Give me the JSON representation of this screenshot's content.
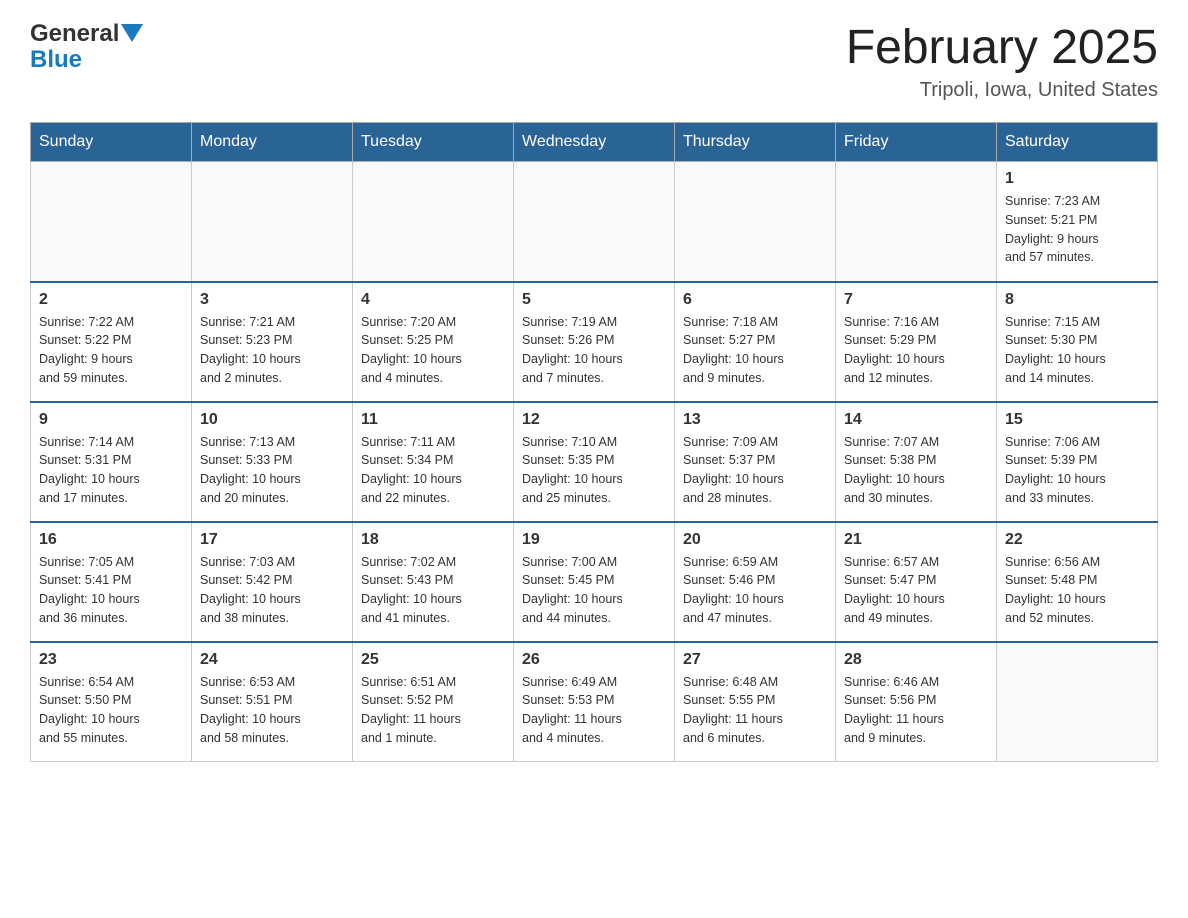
{
  "header": {
    "logo_general": "General",
    "logo_blue": "Blue",
    "month_title": "February 2025",
    "location": "Tripoli, Iowa, United States"
  },
  "days_of_week": [
    "Sunday",
    "Monday",
    "Tuesday",
    "Wednesday",
    "Thursday",
    "Friday",
    "Saturday"
  ],
  "weeks": [
    [
      {
        "day": "",
        "info": ""
      },
      {
        "day": "",
        "info": ""
      },
      {
        "day": "",
        "info": ""
      },
      {
        "day": "",
        "info": ""
      },
      {
        "day": "",
        "info": ""
      },
      {
        "day": "",
        "info": ""
      },
      {
        "day": "1",
        "info": "Sunrise: 7:23 AM\nSunset: 5:21 PM\nDaylight: 9 hours\nand 57 minutes."
      }
    ],
    [
      {
        "day": "2",
        "info": "Sunrise: 7:22 AM\nSunset: 5:22 PM\nDaylight: 9 hours\nand 59 minutes."
      },
      {
        "day": "3",
        "info": "Sunrise: 7:21 AM\nSunset: 5:23 PM\nDaylight: 10 hours\nand 2 minutes."
      },
      {
        "day": "4",
        "info": "Sunrise: 7:20 AM\nSunset: 5:25 PM\nDaylight: 10 hours\nand 4 minutes."
      },
      {
        "day": "5",
        "info": "Sunrise: 7:19 AM\nSunset: 5:26 PM\nDaylight: 10 hours\nand 7 minutes."
      },
      {
        "day": "6",
        "info": "Sunrise: 7:18 AM\nSunset: 5:27 PM\nDaylight: 10 hours\nand 9 minutes."
      },
      {
        "day": "7",
        "info": "Sunrise: 7:16 AM\nSunset: 5:29 PM\nDaylight: 10 hours\nand 12 minutes."
      },
      {
        "day": "8",
        "info": "Sunrise: 7:15 AM\nSunset: 5:30 PM\nDaylight: 10 hours\nand 14 minutes."
      }
    ],
    [
      {
        "day": "9",
        "info": "Sunrise: 7:14 AM\nSunset: 5:31 PM\nDaylight: 10 hours\nand 17 minutes."
      },
      {
        "day": "10",
        "info": "Sunrise: 7:13 AM\nSunset: 5:33 PM\nDaylight: 10 hours\nand 20 minutes."
      },
      {
        "day": "11",
        "info": "Sunrise: 7:11 AM\nSunset: 5:34 PM\nDaylight: 10 hours\nand 22 minutes."
      },
      {
        "day": "12",
        "info": "Sunrise: 7:10 AM\nSunset: 5:35 PM\nDaylight: 10 hours\nand 25 minutes."
      },
      {
        "day": "13",
        "info": "Sunrise: 7:09 AM\nSunset: 5:37 PM\nDaylight: 10 hours\nand 28 minutes."
      },
      {
        "day": "14",
        "info": "Sunrise: 7:07 AM\nSunset: 5:38 PM\nDaylight: 10 hours\nand 30 minutes."
      },
      {
        "day": "15",
        "info": "Sunrise: 7:06 AM\nSunset: 5:39 PM\nDaylight: 10 hours\nand 33 minutes."
      }
    ],
    [
      {
        "day": "16",
        "info": "Sunrise: 7:05 AM\nSunset: 5:41 PM\nDaylight: 10 hours\nand 36 minutes."
      },
      {
        "day": "17",
        "info": "Sunrise: 7:03 AM\nSunset: 5:42 PM\nDaylight: 10 hours\nand 38 minutes."
      },
      {
        "day": "18",
        "info": "Sunrise: 7:02 AM\nSunset: 5:43 PM\nDaylight: 10 hours\nand 41 minutes."
      },
      {
        "day": "19",
        "info": "Sunrise: 7:00 AM\nSunset: 5:45 PM\nDaylight: 10 hours\nand 44 minutes."
      },
      {
        "day": "20",
        "info": "Sunrise: 6:59 AM\nSunset: 5:46 PM\nDaylight: 10 hours\nand 47 minutes."
      },
      {
        "day": "21",
        "info": "Sunrise: 6:57 AM\nSunset: 5:47 PM\nDaylight: 10 hours\nand 49 minutes."
      },
      {
        "day": "22",
        "info": "Sunrise: 6:56 AM\nSunset: 5:48 PM\nDaylight: 10 hours\nand 52 minutes."
      }
    ],
    [
      {
        "day": "23",
        "info": "Sunrise: 6:54 AM\nSunset: 5:50 PM\nDaylight: 10 hours\nand 55 minutes."
      },
      {
        "day": "24",
        "info": "Sunrise: 6:53 AM\nSunset: 5:51 PM\nDaylight: 10 hours\nand 58 minutes."
      },
      {
        "day": "25",
        "info": "Sunrise: 6:51 AM\nSunset: 5:52 PM\nDaylight: 11 hours\nand 1 minute."
      },
      {
        "day": "26",
        "info": "Sunrise: 6:49 AM\nSunset: 5:53 PM\nDaylight: 11 hours\nand 4 minutes."
      },
      {
        "day": "27",
        "info": "Sunrise: 6:48 AM\nSunset: 5:55 PM\nDaylight: 11 hours\nand 6 minutes."
      },
      {
        "day": "28",
        "info": "Sunrise: 6:46 AM\nSunset: 5:56 PM\nDaylight: 11 hours\nand 9 minutes."
      },
      {
        "day": "",
        "info": ""
      }
    ]
  ]
}
